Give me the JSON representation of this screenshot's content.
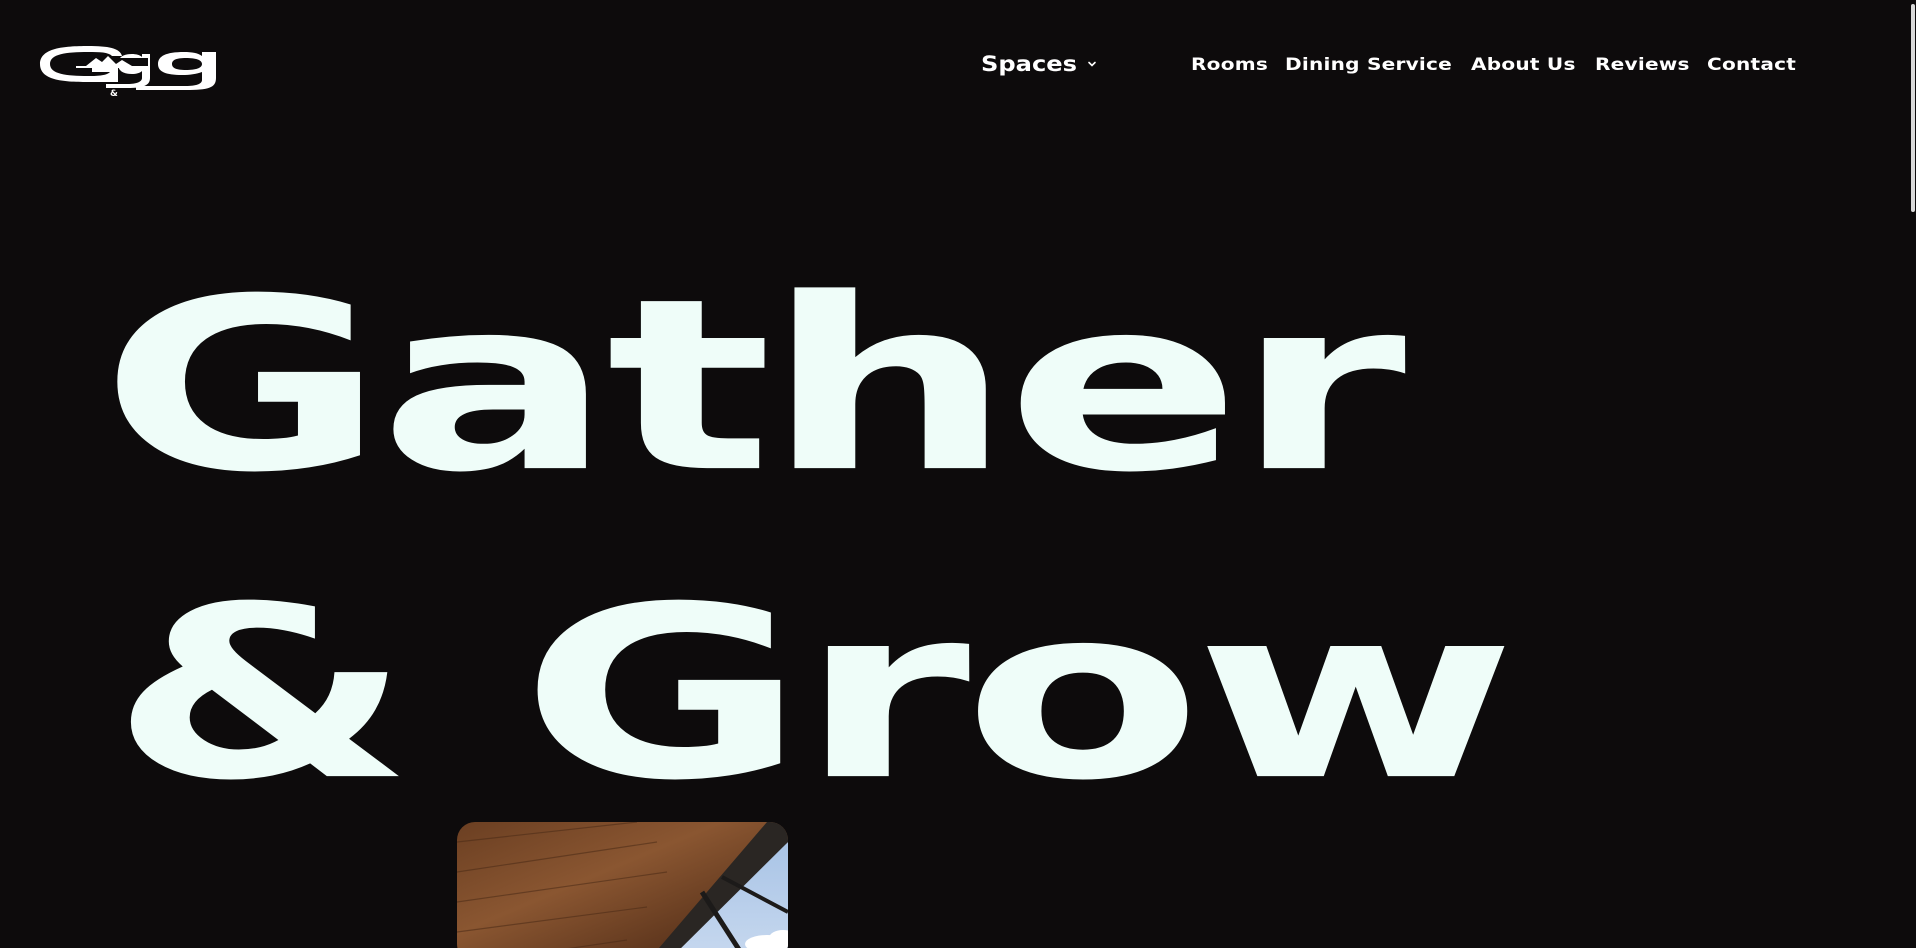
{
  "header": {
    "logo": {
      "main_letters": "Gg",
      "small_mark": "&"
    },
    "nav": {
      "spaces_label": "Spaces",
      "items": [
        {
          "label": "Rooms"
        },
        {
          "label": "Dining Service"
        },
        {
          "label": "About Us"
        },
        {
          "label": "Reviews"
        },
        {
          "label": "Contact"
        }
      ]
    }
  },
  "hero": {
    "line1": "Gather",
    "line2": "& Grow"
  },
  "colors": {
    "background": "#0d0b0c",
    "hero_text": "#effdf9",
    "nav_text": "#ffffff"
  },
  "icons": {
    "spaces_dropdown": "chevron-down-icon",
    "logo_mountain": "mountain-icon"
  }
}
